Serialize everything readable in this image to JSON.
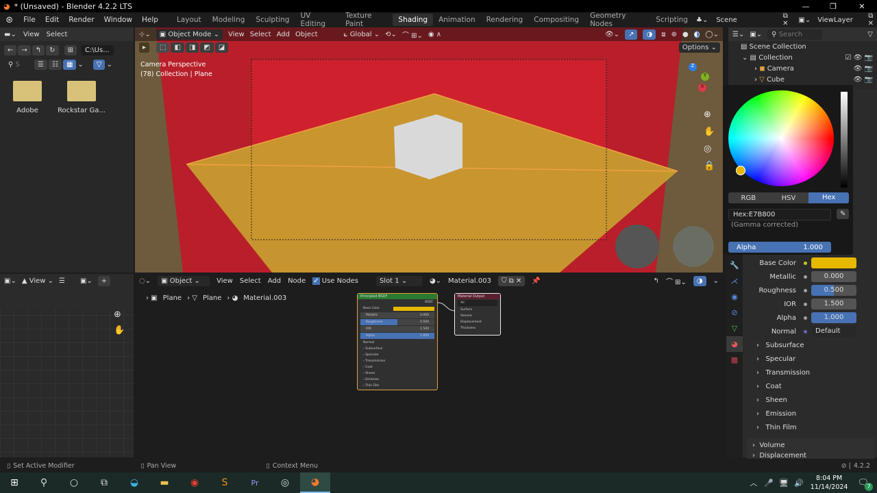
{
  "window": {
    "title": "* (Unsaved) - Blender 4.2.2 LTS",
    "controls": [
      "minimize",
      "restore",
      "close"
    ]
  },
  "menu": [
    "File",
    "Edit",
    "Render",
    "Window",
    "Help"
  ],
  "workspaces": [
    "Layout",
    "Modeling",
    "Sculpting",
    "UV Editing",
    "Texture Paint",
    "Shading",
    "Animation",
    "Rendering",
    "Compositing",
    "Geometry Nodes",
    "Scripting"
  ],
  "active_workspace": "Shading",
  "scene": "Scene",
  "view_layer": "ViewLayer",
  "file_browser": {
    "menu": [
      "View",
      "Select"
    ],
    "path": "C:\\Us...",
    "search_placeholder": "S",
    "folders": [
      "Adobe",
      "Rockstar Ga..."
    ]
  },
  "viewport": {
    "mode": "Object Mode",
    "menu": [
      "View",
      "Select",
      "Add",
      "Object"
    ],
    "orientation": "Global",
    "options": "Options",
    "overlay_title": "Camera Perspective",
    "overlay_sub": "(78) Collection | Plane",
    "gizmo": {
      "z": "Z",
      "y": "Y",
      "x": "X"
    }
  },
  "outliner": {
    "search_placeholder": "Search",
    "items": [
      {
        "label": "Scene Collection",
        "level": 0
      },
      {
        "label": "Collection",
        "level": 1
      },
      {
        "label": "Camera",
        "level": 2
      },
      {
        "label": "Cube",
        "level": 2
      }
    ]
  },
  "color_picker": {
    "tabs": [
      "RGB",
      "HSV",
      "Hex"
    ],
    "active_tab": "Hex",
    "hex_value": "Hex:E7B800",
    "note": "(Gamma corrected)",
    "alpha_label": "Alpha",
    "alpha_value": "1.000",
    "color": "#e7b800"
  },
  "properties": {
    "rows": [
      {
        "label": "Base Color",
        "value": "",
        "fill": 0
      },
      {
        "label": "Metallic",
        "value": "0.000",
        "fill": 0
      },
      {
        "label": "Roughness",
        "value": "0.500",
        "fill": 0.5
      },
      {
        "label": "IOR",
        "value": "1.500",
        "fill": 0
      },
      {
        "label": "Alpha",
        "value": "1.000",
        "fill": 1
      }
    ],
    "normal_label": "Normal",
    "normal_value": "Default",
    "subpanels": [
      "Subsurface",
      "Specular",
      "Transmission",
      "Coat",
      "Sheen",
      "Emission",
      "Thin Film"
    ],
    "volume": "Volume",
    "displacement": "Displacement"
  },
  "image_editor": {
    "view": "View"
  },
  "node_editor": {
    "object": "Object",
    "menu": [
      "View",
      "Select",
      "Add",
      "Node"
    ],
    "use_nodes": "Use Nodes",
    "slot": "Slot 1",
    "material": "Material.003",
    "breadcrumb": [
      "Plane",
      "Plane",
      "Material.003"
    ],
    "bsdf_node": {
      "title": "Principled BSDF",
      "output": "BSDF",
      "rows": [
        {
          "label": "Base Color",
          "value": ""
        },
        {
          "label": "Metallic",
          "value": "0.000"
        },
        {
          "label": "Roughness",
          "value": "0.500"
        },
        {
          "label": "IOR",
          "value": "1.500"
        },
        {
          "label": "Alpha",
          "value": "1.000"
        }
      ],
      "normal": "Normal",
      "panels": [
        "Subsurface",
        "Specular",
        "Transmission",
        "Coat",
        "Sheen",
        "Emission",
        "Thin Film"
      ]
    },
    "output_node": {
      "title": "Material Output",
      "target": "All",
      "inputs": [
        "Surface",
        "Volume",
        "Displacement",
        "Thickness"
      ]
    }
  },
  "status_bar": {
    "left": "Set Active Modifier",
    "middle": "Pan View",
    "right": "Context Menu",
    "version": "4.2.2"
  },
  "taskbar": {
    "time": "8:04 PM",
    "date": "11/14/2024",
    "notifications": "7"
  }
}
